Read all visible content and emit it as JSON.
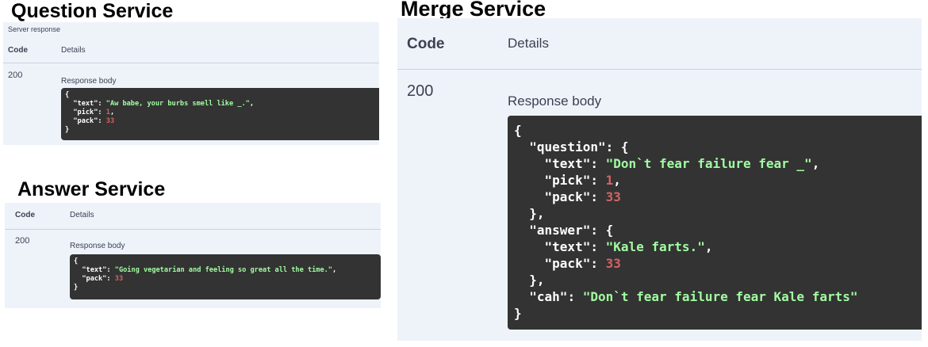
{
  "question_service": {
    "title": "Question Service",
    "server_response_label": "Server response",
    "code_header": "Code",
    "details_header": "Details",
    "code": "200",
    "response_body_label": "Response body",
    "json": {
      "text": "\"Aw babe, your burbs smell like _.\"",
      "pick": "1",
      "pack": "33"
    }
  },
  "answer_service": {
    "title": "Answer Service",
    "code_header": "Code",
    "details_header": "Details",
    "code": "200",
    "response_body_label": "Response body",
    "json": {
      "text": "\"Going vegetarian and feeling so great all the time.\"",
      "pack": "33"
    }
  },
  "merge_service": {
    "title": "Merge Service",
    "code_header": "Code",
    "details_header": "Details",
    "code": "200",
    "response_body_label": "Response body",
    "json": {
      "question": {
        "text": "\"Don`t fear failure fear _\"",
        "pick": "1",
        "pack": "33"
      },
      "answer": {
        "text": "\"Kale farts.\"",
        "pack": "33"
      },
      "cah": "\"Don`t fear failure fear Kale farts\""
    }
  },
  "colors": {
    "panel_bg": "#eef3fa",
    "code_bg": "#333333",
    "string": "#a2fca2",
    "number": "#d36363"
  }
}
